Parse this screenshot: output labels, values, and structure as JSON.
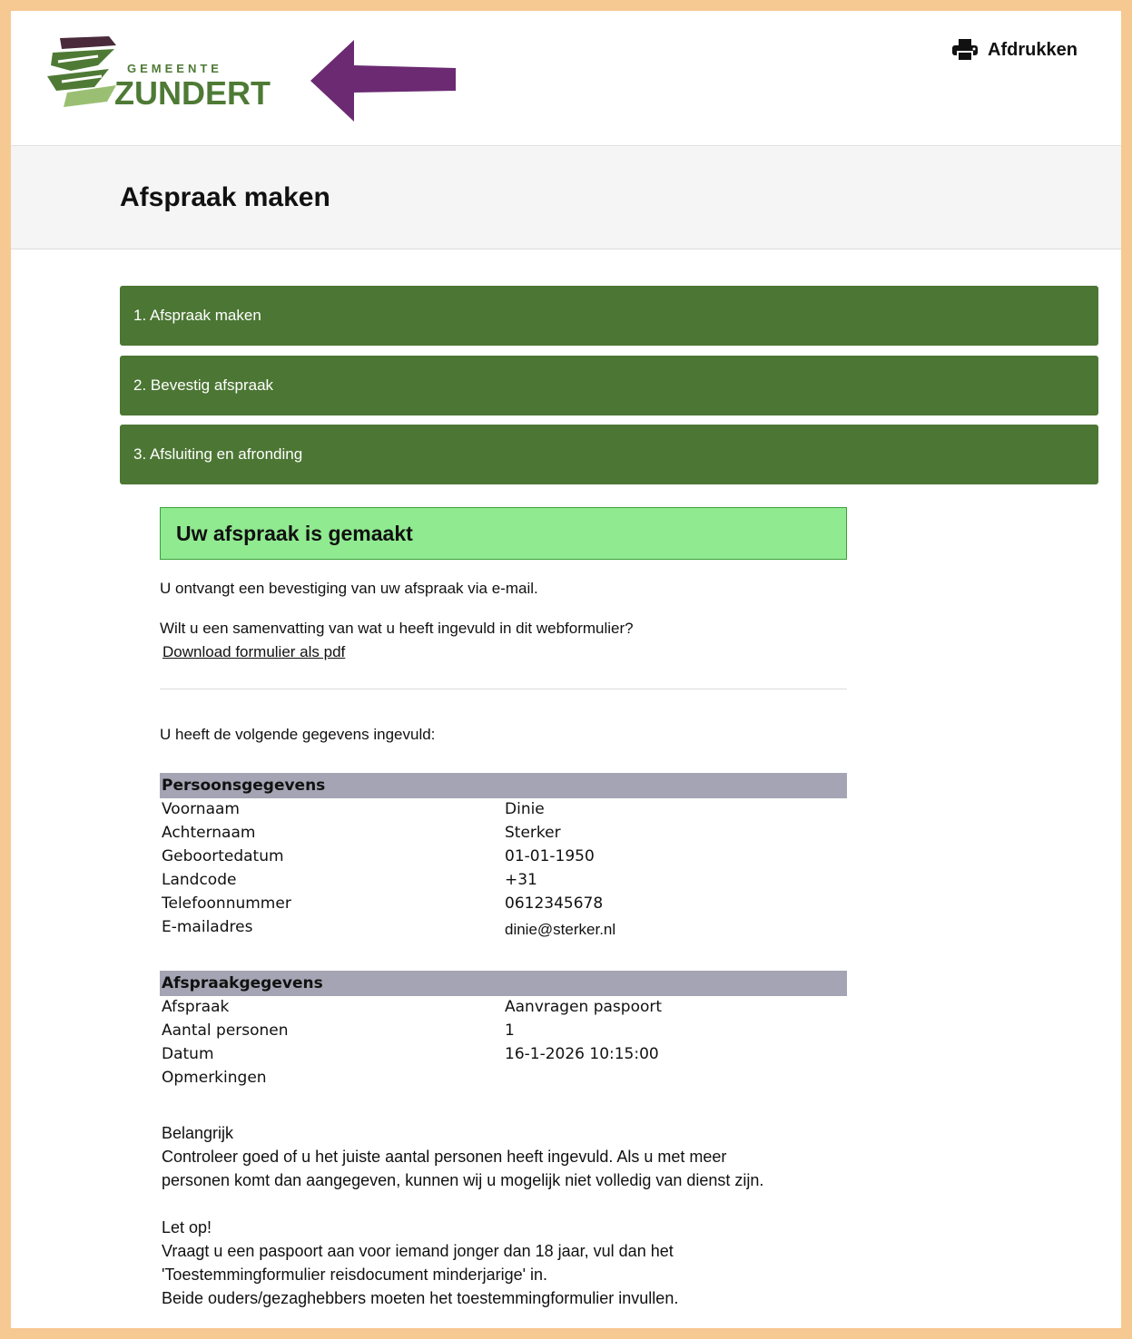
{
  "header": {
    "logo_small": "GEMEENTE",
    "logo_big": "ZUNDERT",
    "print_label": "Afdrukken",
    "arrow_color": "#6b2a72",
    "brand_green": "#4c7634"
  },
  "page_title": "Afspraak maken",
  "steps": [
    {
      "label": "1. Afspraak maken"
    },
    {
      "label": "2. Bevestig afspraak"
    },
    {
      "label": "3. Afsluiting en afronding"
    }
  ],
  "confirmation": {
    "heading": "Uw afspraak is gemaakt",
    "email_text": "U ontvangt een bevestiging van uw afspraak via e-mail.",
    "summary_question": "Wilt u een samenvatting van wat u heeft ingevuld in dit webformulier?",
    "download_link": "Download formulier als pdf",
    "entered_intro": "U heeft de volgende gegevens ingevuld:"
  },
  "personal": {
    "title": "Persoonsgegevens",
    "rows": [
      {
        "label": "Voornaam",
        "value": "Dinie"
      },
      {
        "label": "Achternaam",
        "value": "Sterker"
      },
      {
        "label": "Geboortedatum",
        "value": "01-01-1950"
      },
      {
        "label": "Landcode",
        "value": "+31"
      },
      {
        "label": "Telefoonnummer",
        "value": "0612345678"
      },
      {
        "label": "E-mailadres",
        "value": "dinie@sterker.nl"
      }
    ]
  },
  "appointment": {
    "title": "Afspraakgegevens",
    "rows": [
      {
        "label": "Afspraak",
        "value": "Aanvragen paspoort"
      },
      {
        "label": "Aantal personen",
        "value": "1"
      },
      {
        "label": "Datum",
        "value": "16-1-2026 10:15:00"
      },
      {
        "label": "Opmerkingen",
        "value": ""
      }
    ]
  },
  "notes": {
    "important_title": "Belangrijk",
    "important_text_1": "Controleer goed of u het juiste aantal personen heeft ingevuld. Als u met meer",
    "important_text_2": "personen komt dan aangegeven, kunnen wij u mogelijk niet volledig van dienst zijn.",
    "attention_title": "Let op!",
    "attention_text_1": "Vraagt u een paspoort aan voor iemand jonger dan 18 jaar, vul dan het",
    "attention_text_2": "'Toestemmingformulier reisdocument minderjarige' in.",
    "attention_text_3": "Beide ouders/gezaghebbers moeten het toestemmingformulier invullen."
  }
}
